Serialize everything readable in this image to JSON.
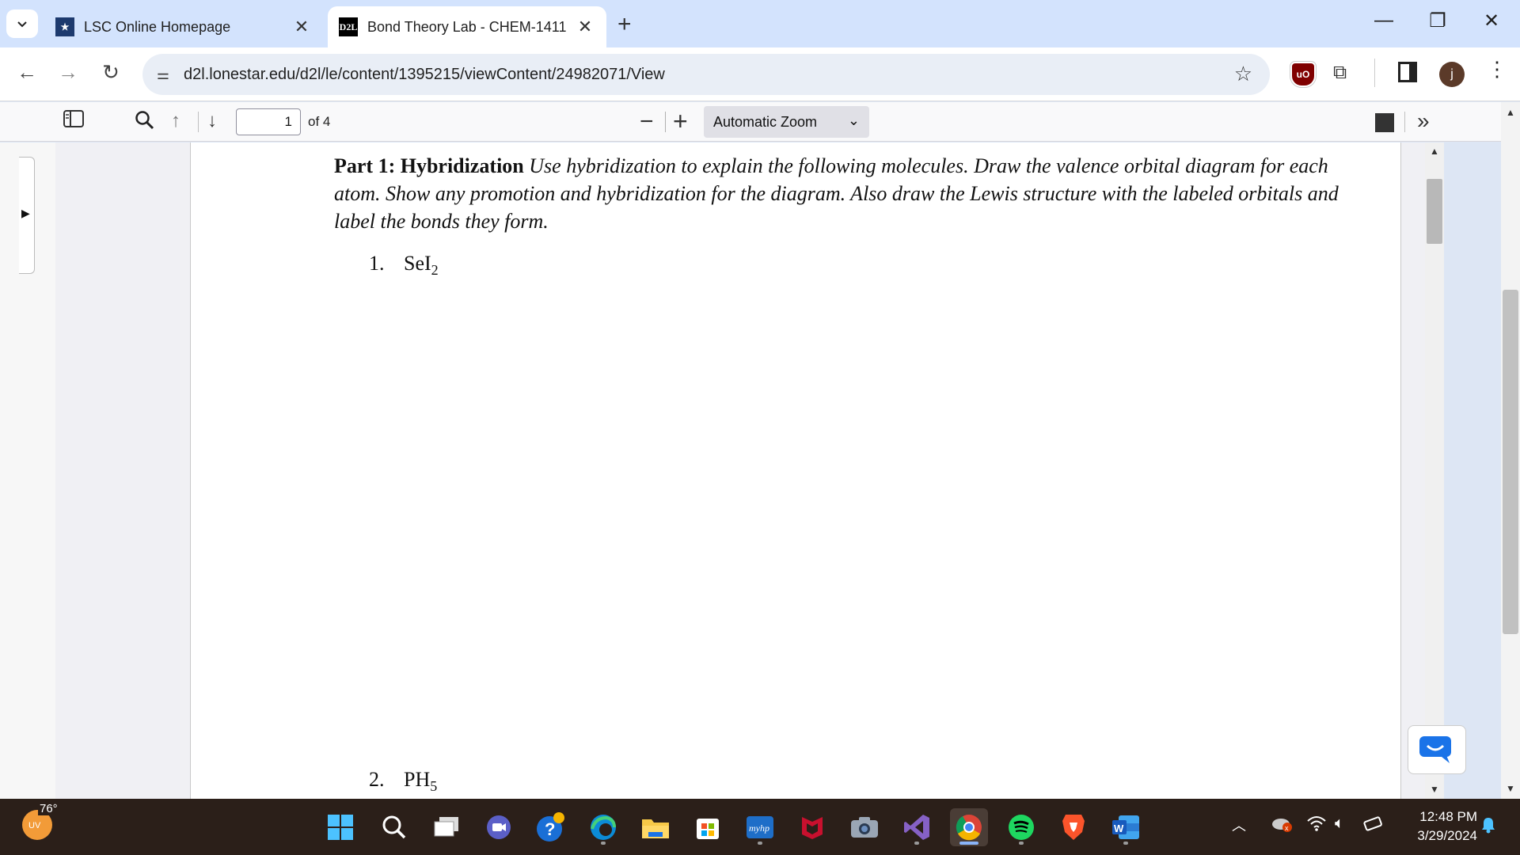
{
  "tabs": [
    {
      "title": "LSC Online Homepage",
      "favicon": "lsc-star-icon"
    },
    {
      "title": "Bond Theory Lab - CHEM-1411",
      "favicon": "D2L"
    }
  ],
  "address_bar": {
    "url": "d2l.lonestar.edu/d2l/le/content/1395215/viewContent/24982071/View"
  },
  "profile": {
    "initial": "j"
  },
  "pdf_toolbar": {
    "page_number": "1",
    "page_count": "of 4",
    "zoom": "Automatic Zoom"
  },
  "document": {
    "part_heading": "Part 1: Hybridization",
    "instructions": "Use hybridization to explain the following molecules. Draw the valence orbital diagram for each atom. Show any promotion and hybridization for the diagram. Also draw the Lewis structure with the labeled orbitals and label the bonds they form.",
    "questions": [
      {
        "number": "1.",
        "formula_main": "SeI",
        "formula_sub": "2"
      },
      {
        "number": "2.",
        "formula_main": "PH",
        "formula_sub": "5"
      }
    ]
  },
  "taskbar": {
    "weather_temp": "76°",
    "weather_badge": "UV",
    "time": "12:48 PM",
    "date": "3/29/2024",
    "word_label": "W"
  },
  "colors": {
    "tabstrip": "#d3e3fd",
    "taskbar": "#2b1f19",
    "ublock": "#800000"
  }
}
